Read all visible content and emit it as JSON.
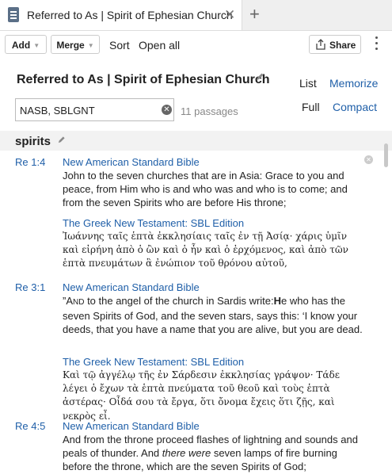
{
  "tab": {
    "title": "Referred to As | Spirit of Ephesian Church",
    "close_glyph": "✕",
    "new_glyph": "+"
  },
  "toolbar": {
    "add": "Add",
    "merge": "Merge",
    "sort": "Sort",
    "open_all": "Open all",
    "share": "Share"
  },
  "document": {
    "title": "Referred to As | Spirit of Ephesian Church",
    "view_list": "List",
    "view_memorize": "Memorize",
    "view_full": "Full",
    "view_compact": "Compact",
    "filter_value": "NASB, SBLGNT",
    "passage_count": "11 passages"
  },
  "section": {
    "title": "spirits"
  },
  "passages": [
    {
      "ref": "Re 1:4",
      "en_version": "New American Standard Bible",
      "en_text": "John to the seven churches that are in Asia: Grace to you and peace, from Him who is and who was and who is to come; and from the seven Spirits who are before His throne;",
      "gr_version": "The Greek New Testament: SBL Edition",
      "gr_text": "Ἰωάννης ταῖς ἑπτὰ ἐκκλησίαις ταῖς ἐν τῇ Ἀσίᾳ· χάρις ὑμῖν καὶ εἰρήνη ἀπὸ ὁ ὢν καὶ ὁ ἦν καὶ ὁ ἐρχόμενος, καὶ ἀπὸ τῶν ἑπτὰ πνευμάτων ἃ ἐνώπιον τοῦ θρόνου αὐτοῦ,"
    },
    {
      "ref": "Re 3:1",
      "en_version": "New American Standard Bible",
      "en_open": "”A",
      "en_sc": "ND",
      "en_mid": " to the angel of the church in Sardis write:",
      "en_bold": "H",
      "en_rest": "e who has the seven Spirits of God, and the seven stars, says this: ‘I know your deeds, that you have a name that you are alive, but you are dead.",
      "gr_version": "The Greek New Testament: SBL Edition",
      "gr_text": "Καὶ τῷ ἀγγέλῳ τῆς ἐν Σάρδεσιν ἐκκλησίας γράψον· Τάδε λέγει ὁ ἔχων τὰ ἑπτὰ πνεύματα τοῦ θεοῦ καὶ τοὺς ἑπτὰ ἀστέρας· Οἶδά σου τὰ ἔργα, ὅτι ὄνομα ἔχεις ὅτι ζῇς, καὶ νεκρὸς εἶ."
    },
    {
      "ref": "Re 4:5",
      "en_version": "New American Standard Bible",
      "en_a": "And from the throne proceed flashes of lightning and sounds and peals of thunder. And ",
      "en_italic": "there were",
      "en_b": " seven lamps of fire burning before the throne, which are the seven Spirits of God;"
    }
  ],
  "icons": [
    "document-icon",
    "close-icon",
    "plus-icon",
    "caret-down-icon",
    "share-icon",
    "more-icon",
    "pencil-icon",
    "clear-icon"
  ]
}
